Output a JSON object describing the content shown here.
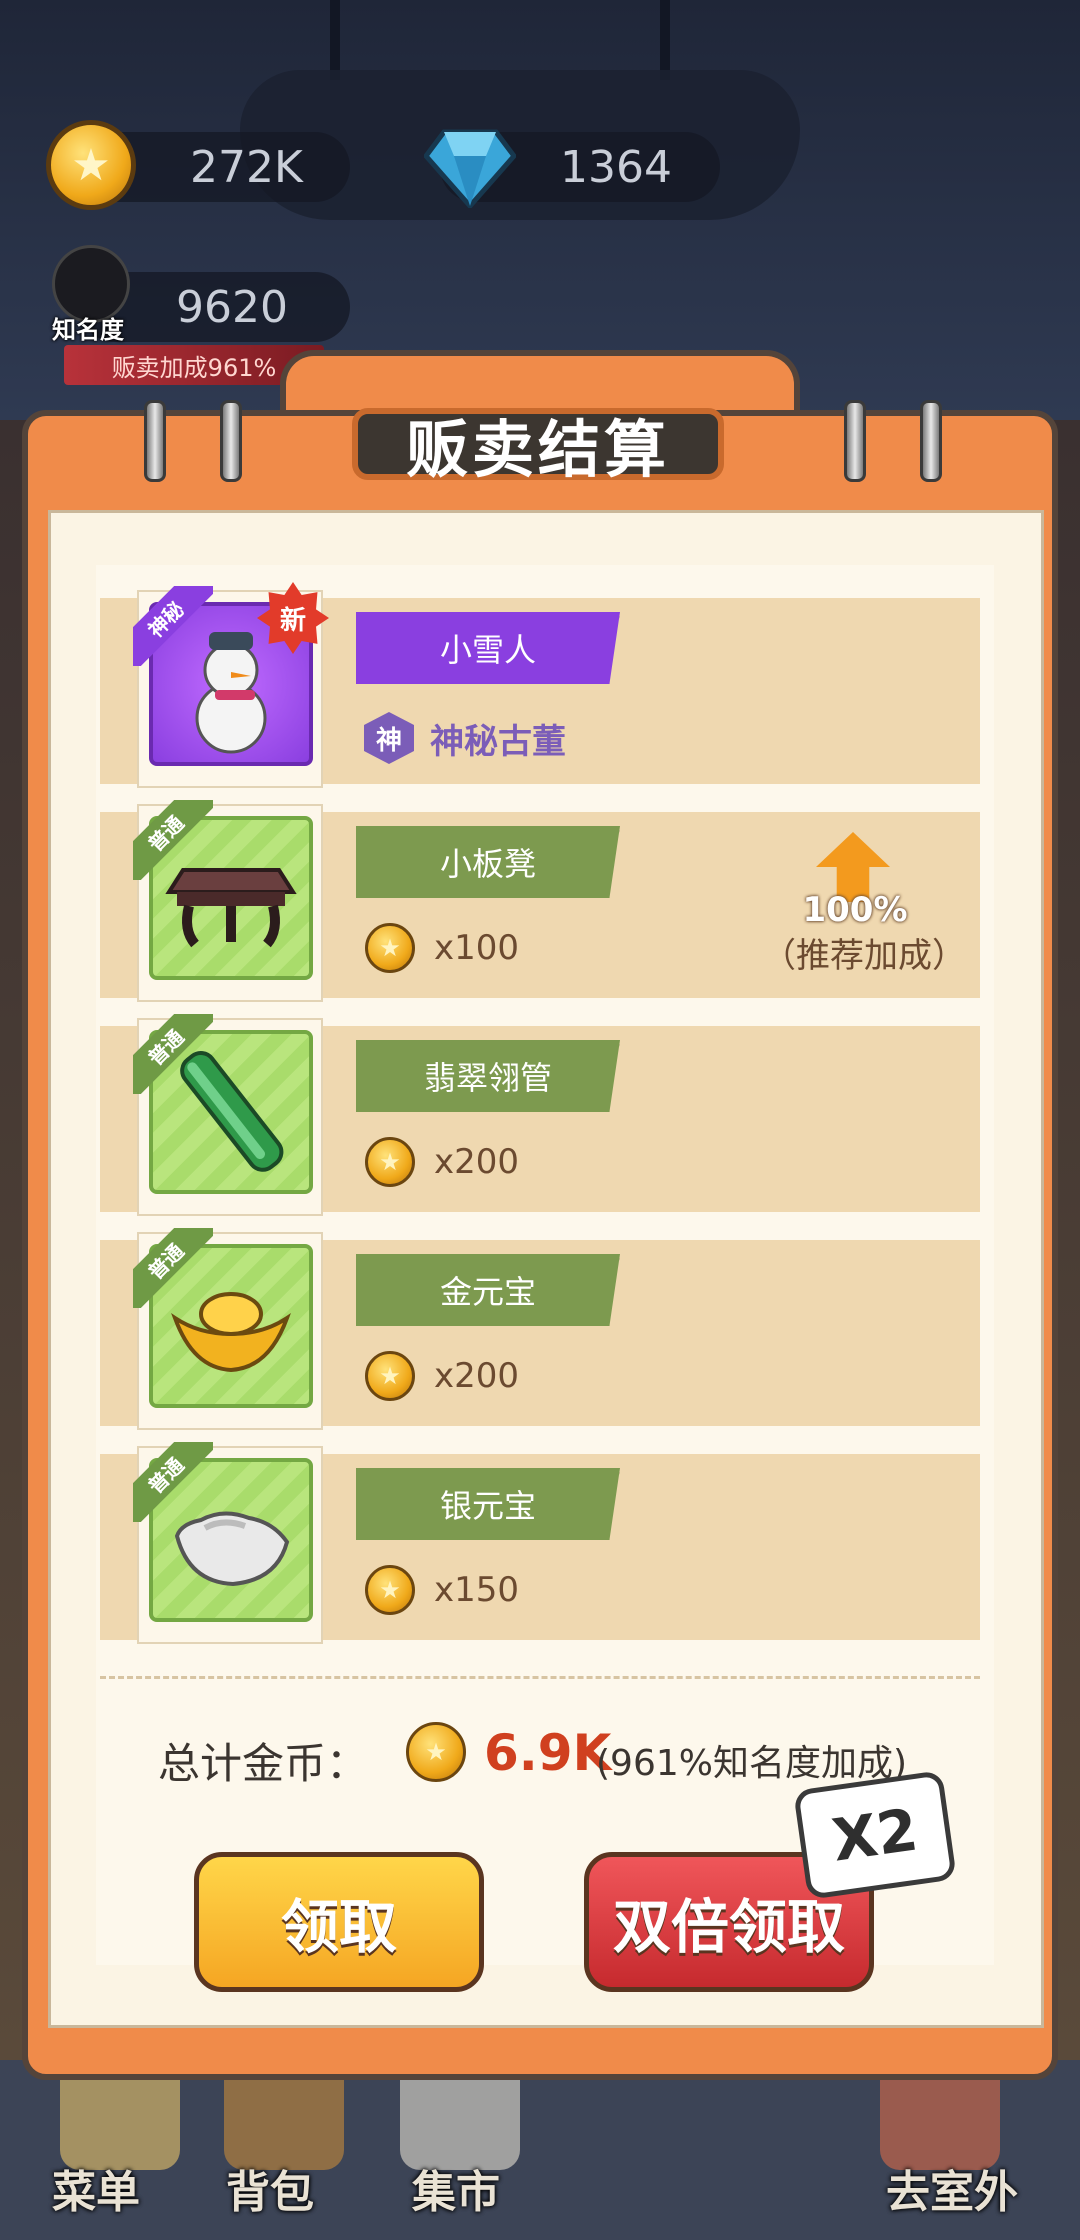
{
  "hud": {
    "coins": "272K",
    "gems": "1364",
    "fame_value": "9620",
    "fame_label": "知名度",
    "fame_bonus": "贩卖加成961%"
  },
  "panel": {
    "title": "贩卖结算"
  },
  "items": [
    {
      "name": "小雪人",
      "tag": "神秘",
      "is_new": true,
      "new_label": "新",
      "rarity_icon": "神",
      "rarity_label": "神秘古董",
      "price": ""
    },
    {
      "name": "小板凳",
      "tag": "普通",
      "price": "x100",
      "boost_pct": "100%",
      "boost_label": "（推荐加成）"
    },
    {
      "name": "翡翠翎管",
      "tag": "普通",
      "price": "x200"
    },
    {
      "name": "金元宝",
      "tag": "普通",
      "price": "x200"
    },
    {
      "name": "银元宝",
      "tag": "普通",
      "price": "x150"
    }
  ],
  "summary": {
    "total_label": "总计金币：",
    "total_value": "6.9K",
    "total_note": "(961%知名度加成)"
  },
  "buttons": {
    "claim": "领取",
    "double_claim": "双倍领取",
    "x2_badge": "X2"
  },
  "nav": {
    "menu": "菜单",
    "bag": "背包",
    "market": "集市",
    "outdoor": "去室外"
  },
  "colors": {
    "panel_orange": "#f08b4a",
    "row_beige": "#efd8b0",
    "tag_green": "#7d9a4f",
    "tag_purple": "#8a3fe0",
    "total_red": "#d0401f",
    "button_yellow": "#f5a623",
    "button_red": "#c62a2e"
  },
  "icons": [
    "coin-icon",
    "diamond-icon",
    "fame-avatar-icon",
    "snowman-icon",
    "stool-icon",
    "jade-tube-icon",
    "gold-ingot-icon",
    "silver-ingot-icon",
    "up-arrow-icon",
    "star-new-icon"
  ]
}
